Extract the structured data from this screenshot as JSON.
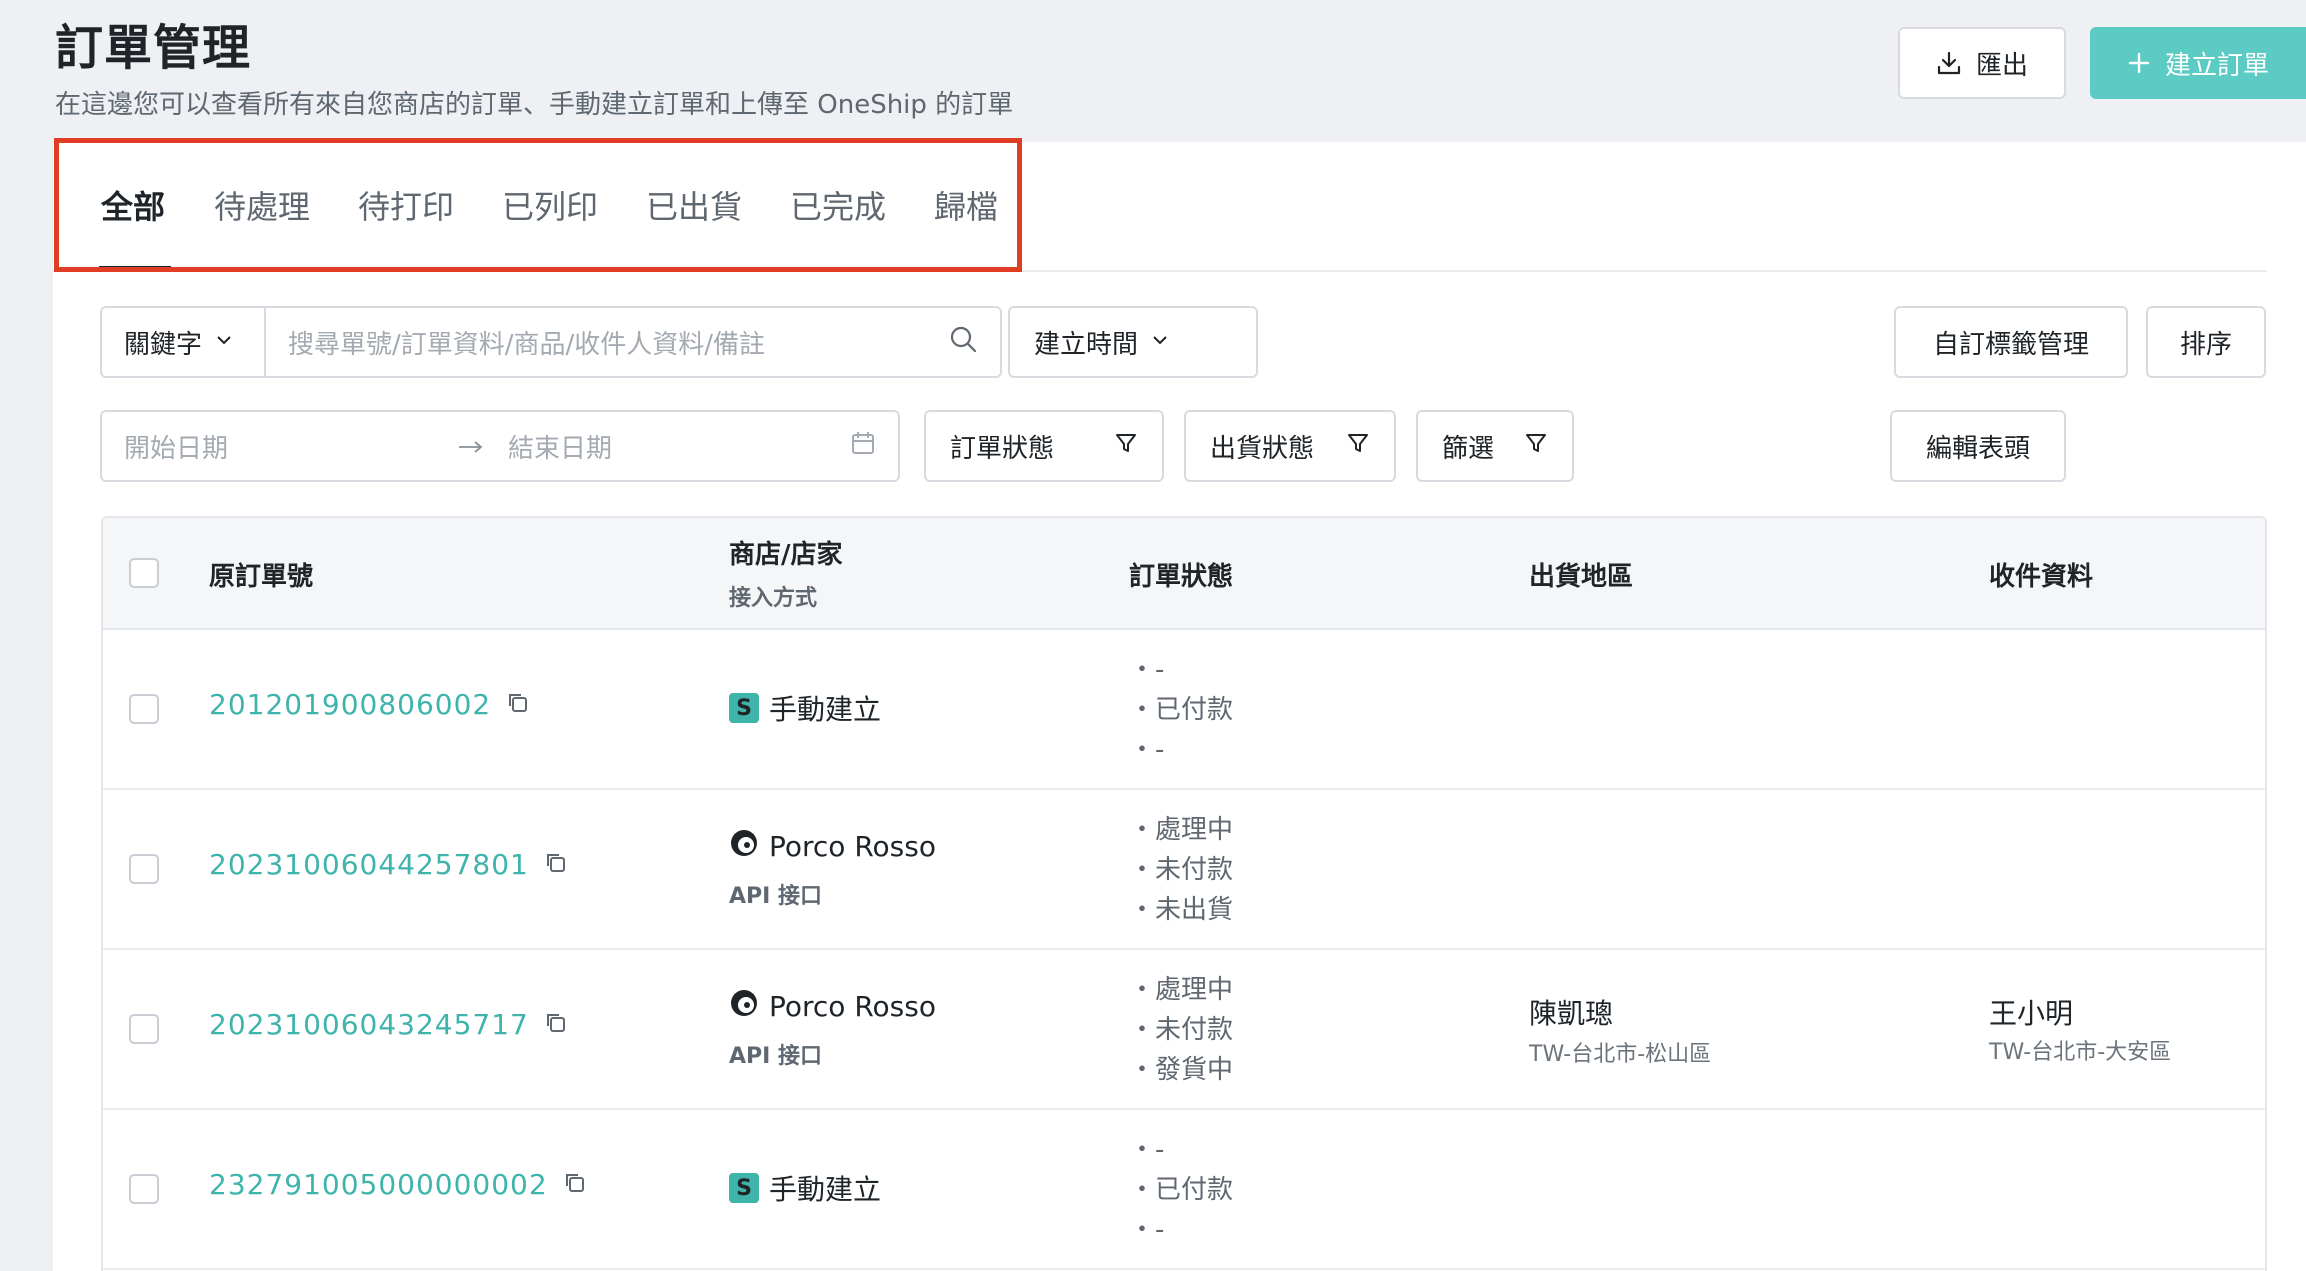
{
  "header": {
    "title": "訂單管理",
    "subtitle": "在這邊您可以查看所有來自您商店的訂單、手動建立訂單和上傳至 OneShip 的訂單",
    "export_label": "匯出",
    "create_label": "建立訂單"
  },
  "tabs": [
    "全部",
    "待處理",
    "待打印",
    "已列印",
    "已出貨",
    "已完成",
    "歸檔"
  ],
  "filters": {
    "keyword_label": "關鍵字",
    "search_placeholder": "搜尋單號/訂單資料/商品/收件人資料/備註",
    "time_label": "建立時間",
    "tag_mgmt_label": "自訂標籤管理",
    "sort_label": "排序",
    "start_date_placeholder": "開始日期",
    "end_date_placeholder": "結束日期",
    "order_status_label": "訂單狀態",
    "ship_status_label": "出貨狀態",
    "filter_label": "篩選",
    "edit_header_label": "編輯表頭"
  },
  "table": {
    "headers": {
      "order_no": "原訂單號",
      "store": "商店/店家",
      "store_sub": "接入方式",
      "order_status": "訂單狀態",
      "ship_region": "出貨地區",
      "recipient": "收件資料"
    },
    "rows": [
      {
        "order_no": "201201900806002",
        "store_type": "manual",
        "store": "手動建立",
        "store_sub": "",
        "status": [
          "・-",
          "・已付款",
          "・-"
        ],
        "ship_name": "",
        "ship_sub": "",
        "recipient_name": "",
        "recipient_sub": ""
      },
      {
        "order_no": "20231006044257801",
        "store_type": "api",
        "store": "Porco Rosso",
        "store_sub": "API 接口",
        "status": [
          "・處理中",
          "・未付款",
          "・未出貨"
        ],
        "ship_name": "",
        "ship_sub": "",
        "recipient_name": "",
        "recipient_sub": ""
      },
      {
        "order_no": "20231006043245717",
        "store_type": "api",
        "store": "Porco Rosso",
        "store_sub": "API 接口",
        "status": [
          "・處理中",
          "・未付款",
          "・發貨中"
        ],
        "ship_name": "陳凱璁",
        "ship_sub": "TW-台北市-松山區",
        "recipient_name": "王小明",
        "recipient_sub": "TW-台北市-大安區"
      },
      {
        "order_no": "232791005000000002",
        "store_type": "manual",
        "store": "手動建立",
        "store_sub": "",
        "status": [
          "・-",
          "・已付款",
          "・-"
        ],
        "ship_name": "",
        "ship_sub": "",
        "recipient_name": "",
        "recipient_sub": ""
      }
    ],
    "manual_badge": "S"
  },
  "colors": {
    "accent": "#5ccbc3",
    "link": "#3fb4ab",
    "highlight": "#e03e24"
  }
}
